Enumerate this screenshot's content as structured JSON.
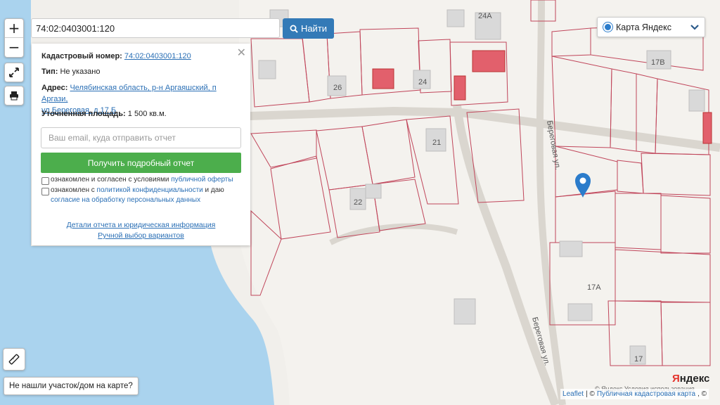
{
  "controls": {
    "zoom_in": "+",
    "zoom_out": "−"
  },
  "search": {
    "value": "74:02:0403001:120",
    "find_label": "Найти"
  },
  "panel": {
    "cad_label": "Кадастровый номер:",
    "cad_value": "74:02:0403001:120",
    "type_label": "Тип:",
    "type_value": "Не указано",
    "address_label": "Адрес:",
    "address_value_1": "Челябинская область, р-н Аргаяшский, п Аргази,",
    "address_value_2": "ул Береговая, д 17 Б",
    "area_label": "Уточненная площадь:",
    "area_value": "1 500 кв.м.",
    "email_placeholder": "Ваш email, куда отправить отчет",
    "report_button": "Получить подробный отчет",
    "consent1_text": "ознакомлен и согласен с условиями",
    "consent1_link": "публичной оферты",
    "consent2_text_a": "ознакомлен с",
    "consent2_link_a": "политикой конфиденциальности",
    "consent2_text_b": "и даю",
    "consent2_link_b": "согласие на обработку персональных данных",
    "details_link": "Детали отчета и юридическая информация",
    "manual_link": "Ручной выбор вариантов"
  },
  "layer_select": {
    "value": "Карта Яндекс"
  },
  "not_found": "Не нашли участок/дом на карте?",
  "attribution": {
    "leaflet": "Leaflet",
    "separator": "| ©",
    "source": "Публичная кадастровая карта",
    "trail": ", ©"
  },
  "yandex_logo": {
    "first": "Я",
    "rest": "ндекс"
  },
  "terms": "© Яндекс  Условия использования",
  "map_labels": {
    "house_24a": "24А",
    "house_17v": "17В",
    "house_26": "26",
    "house_24": "24",
    "house_21": "21",
    "house_22": "22",
    "house_17a": "17А",
    "house_17": "17",
    "street_1": "Береговая ул.",
    "street_2": "Береговая ул."
  },
  "colors": {
    "water": "#aad3ee",
    "land": "#f1efeb",
    "parcel_line": "#c0455a",
    "marker": "#2b7ccb",
    "building": "#d9d9d9",
    "highlight_building": "#e2606c"
  }
}
